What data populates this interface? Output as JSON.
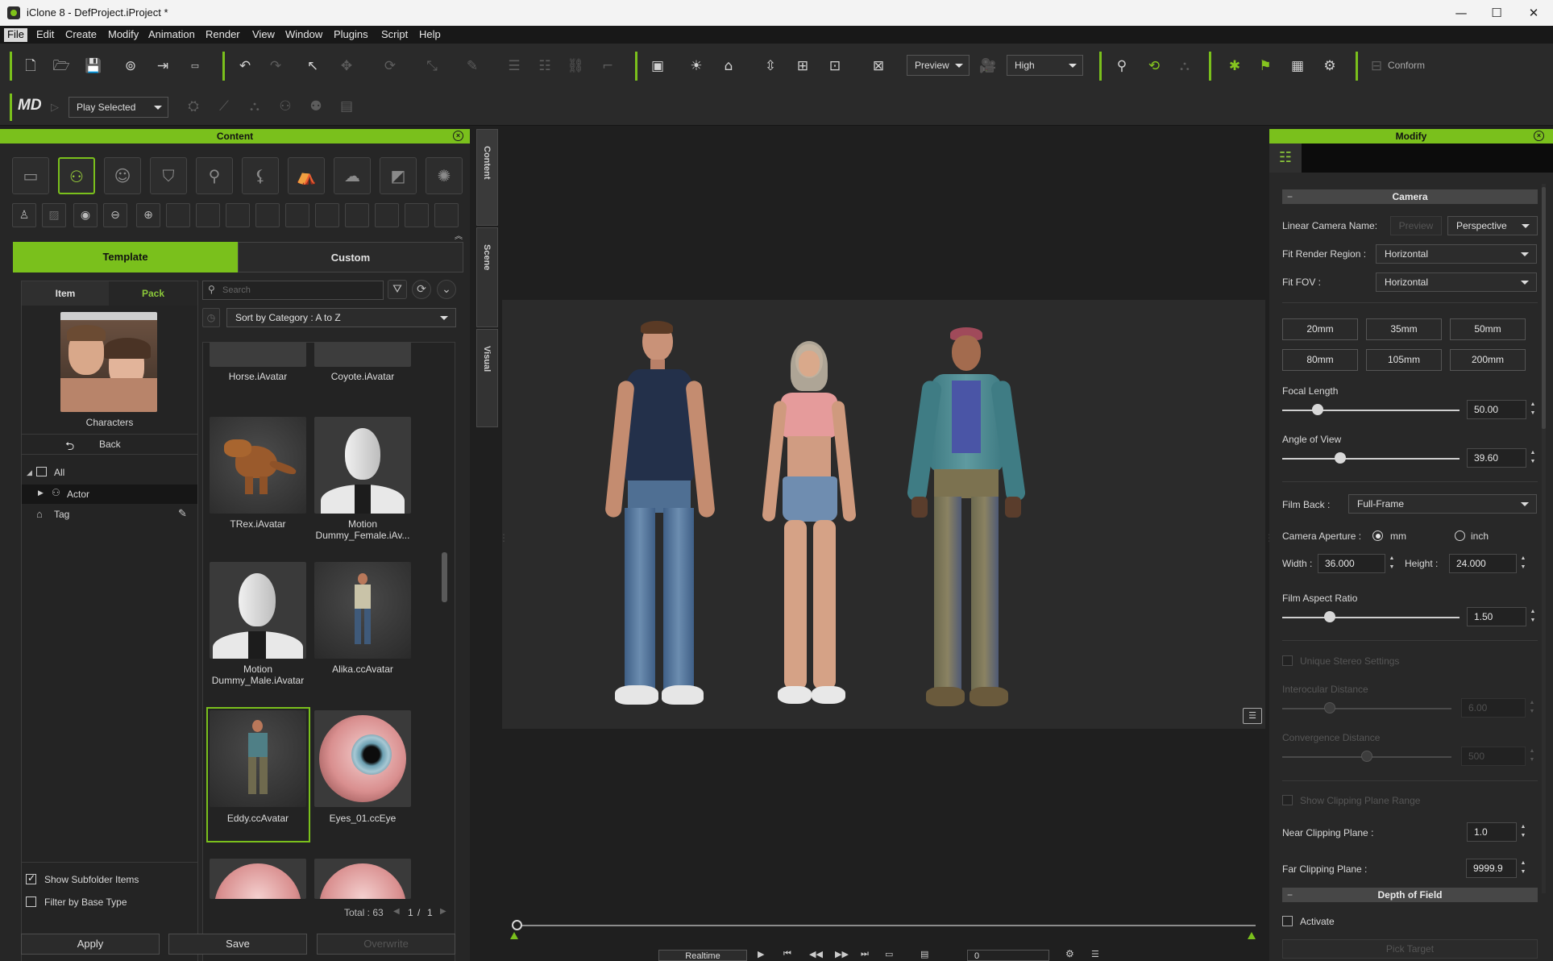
{
  "window": {
    "title": "iClone 8 - DefProject.iProject *",
    "minimize": "—",
    "maximize": "☐",
    "close": "✕"
  },
  "menu": [
    "File",
    "Edit",
    "Create",
    "Modify",
    "Animation",
    "Render",
    "View",
    "Window",
    "Plugins",
    "Script",
    "Help"
  ],
  "toolbar": {
    "preview_mode": "Preview",
    "quality": "High",
    "conform_label": "Conform",
    "play_selected": "Play Selected",
    "md_logo": "MD"
  },
  "content_panel": {
    "title": "Content",
    "tabs": [
      "Template",
      "Custom"
    ],
    "active_tab": "Template",
    "sub_tabs": [
      "Item",
      "Pack"
    ],
    "active_sub_tab": "Pack",
    "folder_label": "Characters",
    "back_label": "Back",
    "tree": {
      "all": "All",
      "actor": "Actor",
      "tag": "Tag"
    },
    "search_placeholder": "Search",
    "sort_label": "Sort by Category : A to Z",
    "items": [
      {
        "label": "Horse.iAvatar"
      },
      {
        "label": "Coyote.iAvatar"
      },
      {
        "label": "TRex.iAvatar"
      },
      {
        "label": "Motion Dummy_Female.iAv..."
      },
      {
        "label": "Motion Dummy_Male.iAvatar"
      },
      {
        "label": "Alika.ccAvatar"
      },
      {
        "label": "Eddy.ccAvatar"
      },
      {
        "label": "Eyes_01.ccEye"
      }
    ],
    "selected_item": "Eddy.ccAvatar",
    "show_subfolder": "Show Subfolder Items",
    "show_subfolder_checked": true,
    "filter_base": "Filter by Base Type",
    "filter_base_checked": false,
    "total": "Total : 63",
    "page_current": "1",
    "page_sep": "/",
    "page_total": "1",
    "apply": "Apply",
    "save": "Save",
    "overwrite": "Overwrite"
  },
  "side_tabs": [
    "Content",
    "Scene",
    "Visual"
  ],
  "modify_panel": {
    "title": "Modify",
    "camera_section": "Camera",
    "linear_camera_name": "Linear Camera Name:",
    "preview_btn": "Preview",
    "perspective": "Perspective",
    "fit_render_region": "Fit Render Region :",
    "fit_render_value": "Horizontal",
    "fit_fov": "Fit FOV :",
    "fit_fov_value": "Horizontal",
    "focal_presets": [
      "20mm",
      "35mm",
      "50mm",
      "80mm",
      "105mm",
      "200mm"
    ],
    "focal_length_label": "Focal Length",
    "focal_length_value": "50.00",
    "angle_of_view_label": "Angle of View",
    "angle_of_view_value": "39.60",
    "film_back_label": "Film Back :",
    "film_back_value": "Full-Frame",
    "camera_aperture_label": "Camera Aperture :",
    "unit_mm": "mm",
    "unit_inch": "inch",
    "width_label": "Width :",
    "width_value": "36.000",
    "height_label": "Height :",
    "height_value": "24.000",
    "film_aspect_label": "Film Aspect Ratio",
    "film_aspect_value": "1.50",
    "unique_stereo": "Unique Stereo Settings",
    "interocular_label": "Interocular Distance",
    "interocular_value": "6.00",
    "convergence_label": "Convergence Distance",
    "convergence_value": "500",
    "show_clipping": "Show Clipping Plane Range",
    "near_clip_label": "Near Clipping Plane :",
    "near_clip_value": "1.0",
    "far_clip_label": "Far Clipping Plane :",
    "far_clip_value": "9999.9",
    "dof_section": "Depth of Field",
    "activate": "Activate",
    "pick_target": "Pick Target"
  },
  "playback": {
    "realtime": "Realtime",
    "frame": "0"
  },
  "colors": {
    "accent": "#7ac01c",
    "panel_bg": "#262626",
    "viewport_bg": "#2b2b2b"
  }
}
